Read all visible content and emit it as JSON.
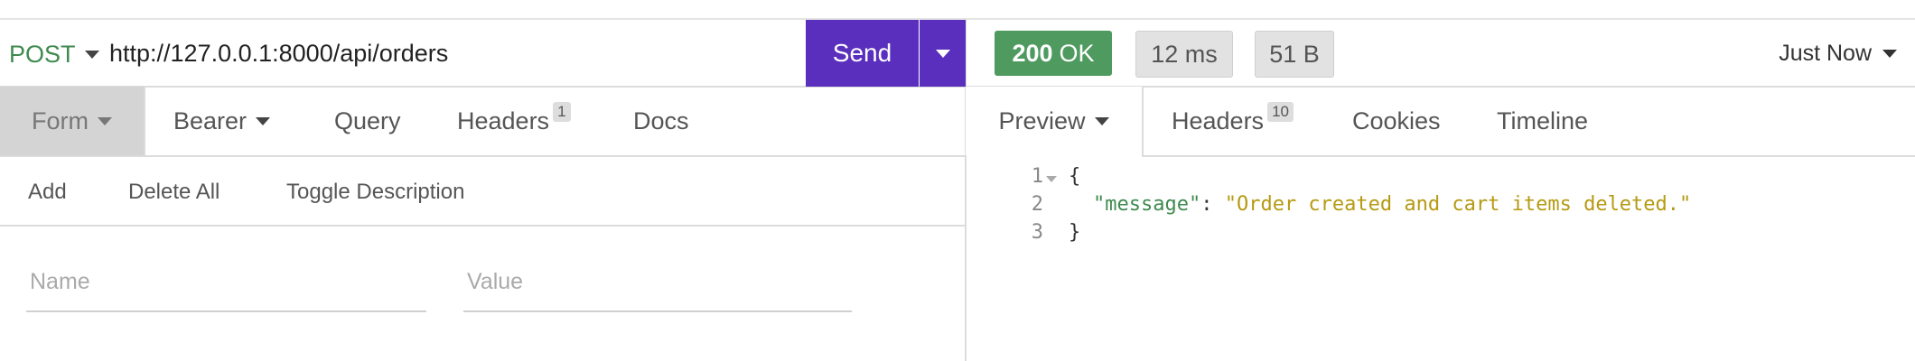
{
  "request": {
    "method": "POST",
    "url": "http://127.0.0.1:8000/api/orders",
    "send_label": "Send"
  },
  "request_tabs": [
    {
      "label": "Form",
      "has_dropdown": true,
      "active": true
    },
    {
      "label": "Bearer",
      "has_dropdown": true
    },
    {
      "label": "Query"
    },
    {
      "label": "Headers",
      "badge": "1"
    },
    {
      "label": "Docs"
    }
  ],
  "form_toolbar": {
    "add": "Add",
    "delete_all": "Delete All",
    "toggle_description": "Toggle Description"
  },
  "form_fields": {
    "name_placeholder": "Name",
    "value_placeholder": "Value"
  },
  "response": {
    "status_code": "200",
    "status_text": "OK",
    "time": "12 ms",
    "size": "51 B",
    "history": "Just Now"
  },
  "response_tabs": [
    {
      "label": "Preview",
      "has_dropdown": true,
      "active": true
    },
    {
      "label": "Headers",
      "badge": "10"
    },
    {
      "label": "Cookies"
    },
    {
      "label": "Timeline"
    }
  ],
  "response_body": {
    "line_numbers": [
      "1",
      "2",
      "3"
    ],
    "open_brace": "{",
    "key": "\"message\"",
    "colon": ": ",
    "value": "\"Order created and cart items deleted.\"",
    "close_brace": "}"
  },
  "colors": {
    "accent": "#5a2fbd",
    "status_ok": "#4e9a5f",
    "method": "#3f8a4f",
    "json_string": "#b59a12"
  }
}
